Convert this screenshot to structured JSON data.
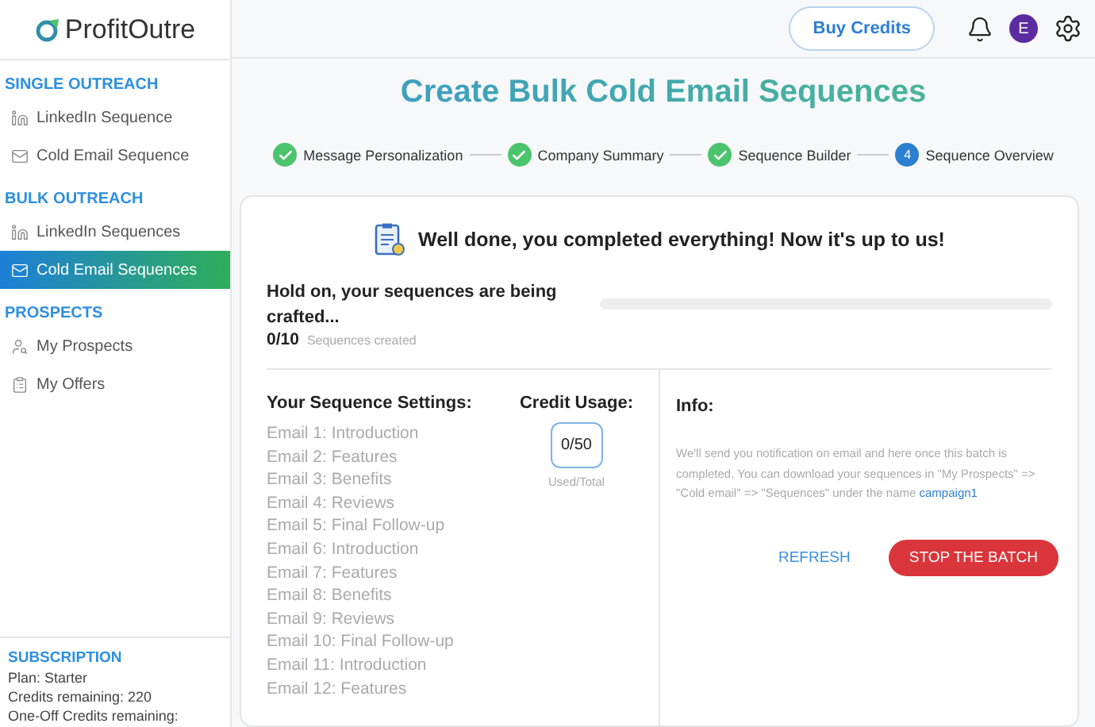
{
  "logo": {
    "text": "ProfitOutre"
  },
  "sidebar": {
    "sections": [
      {
        "title": "SINGLE OUTREACH",
        "items": [
          {
            "label": "LinkedIn Sequence",
            "kind": "linkedin",
            "selected": false
          },
          {
            "label": "Cold Email Sequence",
            "kind": "mail",
            "selected": false
          }
        ]
      },
      {
        "title": "BULK OUTREACH",
        "items": [
          {
            "label": "LinkedIn Sequences",
            "kind": "linkedin",
            "selected": false
          },
          {
            "label": "Cold Email Sequences",
            "kind": "mail",
            "selected": true
          }
        ]
      },
      {
        "title": "PROSPECTS",
        "items": [
          {
            "label": "My Prospects",
            "kind": "search",
            "selected": false
          },
          {
            "label": "My Offers",
            "kind": "offers",
            "selected": false
          }
        ]
      }
    ],
    "subscription": {
      "title": "SUBSCRIPTION",
      "lines": [
        "Plan: Starter",
        "Credits remaining: 220",
        "One-Off Credits remaining:"
      ]
    }
  },
  "header": {
    "buy_button": "Buy Credits",
    "avatar": "E"
  },
  "title": "Create Bulk Cold Email Sequences",
  "steps": [
    {
      "label": "Message Personalization",
      "completed": true
    },
    {
      "label": "Company Summary",
      "completed": true
    },
    {
      "label": "Sequence Builder",
      "completed": true
    },
    {
      "label": "Sequence Overview",
      "completed": false,
      "number": "4"
    }
  ],
  "card": {
    "heading": "Well done, you completed everything! Now it's up to us!",
    "progress": {
      "text": "Hold on, your sequences are being crafted...",
      "count": "0/10",
      "count_label": "Sequences created",
      "level": 0
    },
    "settings": {
      "title": "Your Sequence Settings:",
      "emails": [
        "Email 1: Introduction",
        "Email 2: Features",
        "Email 3: Benefits",
        "Email 4: Reviews",
        "Email 5: Final Follow-up",
        "Email 6: Introduction",
        "Email 7: Features",
        "Email 8: Benefits",
        "Email 9: Reviews",
        "Email 10: Final Follow-up",
        "Email 11: Introduction",
        "Email 12: Features"
      ]
    },
    "credits": {
      "title": "Credit Usage:",
      "value": "0/50",
      "caption": "Used/Total"
    },
    "info": {
      "title": "Info:",
      "text": "We'll send you notification on email and here once this batch is completed. You can download your sequences in \"My Prospects\" => \"Cold email\" => \"Sequences\" under the name",
      "link": "campaign1"
    },
    "buttons": {
      "refresh": "REFRESH",
      "stop": "STOP THE BATCH"
    }
  }
}
